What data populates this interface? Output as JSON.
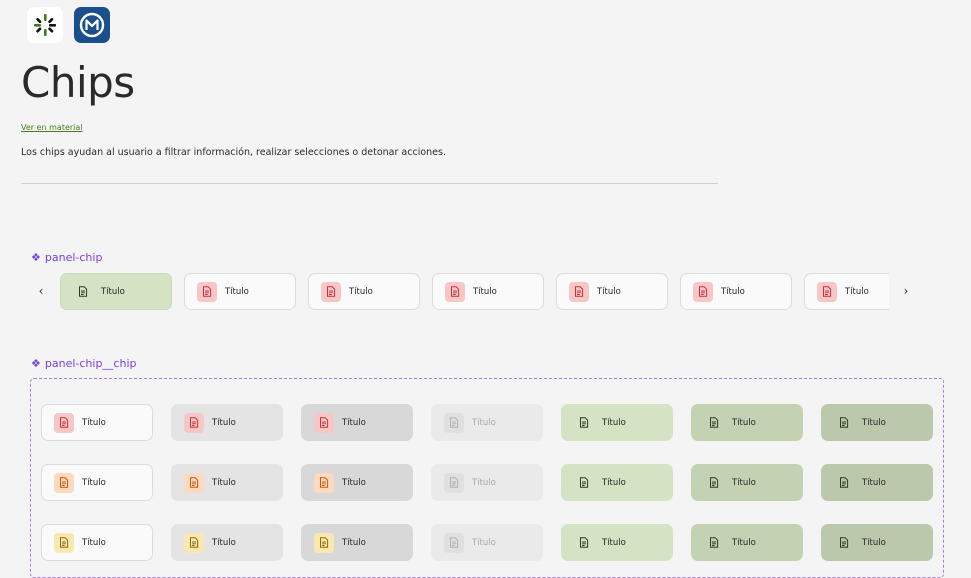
{
  "header": {
    "title": "Chips",
    "link": "Ver en material",
    "description": "Los chips ayudan al usuario a filtrar información, realizar selecciones o detonar acciones."
  },
  "panel_chip": {
    "title": "panel-chip",
    "prev_icon": "chevron-left-icon",
    "next_icon": "chevron-right-icon",
    "chips": [
      {
        "label": "Título",
        "selected": true
      },
      {
        "label": "Título",
        "selected": false
      },
      {
        "label": "Título",
        "selected": false
      },
      {
        "label": "Título",
        "selected": false
      },
      {
        "label": "Título",
        "selected": false
      },
      {
        "label": "Título",
        "selected": false
      },
      {
        "label": "Título",
        "selected": false
      }
    ]
  },
  "panel_chip_chip": {
    "title": "panel-chip__chip",
    "rows": [
      {
        "accent_bg": "#f7c7c7",
        "accent_fg": "#c7333a"
      },
      {
        "accent_bg": "#fdd9bf",
        "accent_fg": "#c25a10"
      },
      {
        "accent_bg": "#fbe8b0",
        "accent_fg": "#8a6a0a"
      }
    ],
    "states": [
      {
        "bg": "#fafafa",
        "border": "#dcdcdc",
        "accent": true
      },
      {
        "bg": "#e4e4e4",
        "border": "#e4e4e4",
        "accent": true
      },
      {
        "bg": "#d8d8d8",
        "border": "#d8d8d8",
        "accent": true
      },
      {
        "bg": "#eaeaea",
        "border": "#eaeaea",
        "accent": false,
        "disabled": true
      },
      {
        "bg": "#d3e3c3",
        "border": "#d3e3c3",
        "accent": false
      },
      {
        "bg": "#c4d2b4",
        "border": "#c4d2b4",
        "accent": false
      },
      {
        "bg": "#bbc8ab",
        "border": "#bbc8ab",
        "accent": false
      }
    ],
    "label": "Título"
  },
  "colors": {
    "accent_purple": "#7b3ee0",
    "link_green": "#4c7a1f",
    "chip_icon_red_bg": "#f7c7c7",
    "chip_icon_red_fg": "#c7333a"
  }
}
